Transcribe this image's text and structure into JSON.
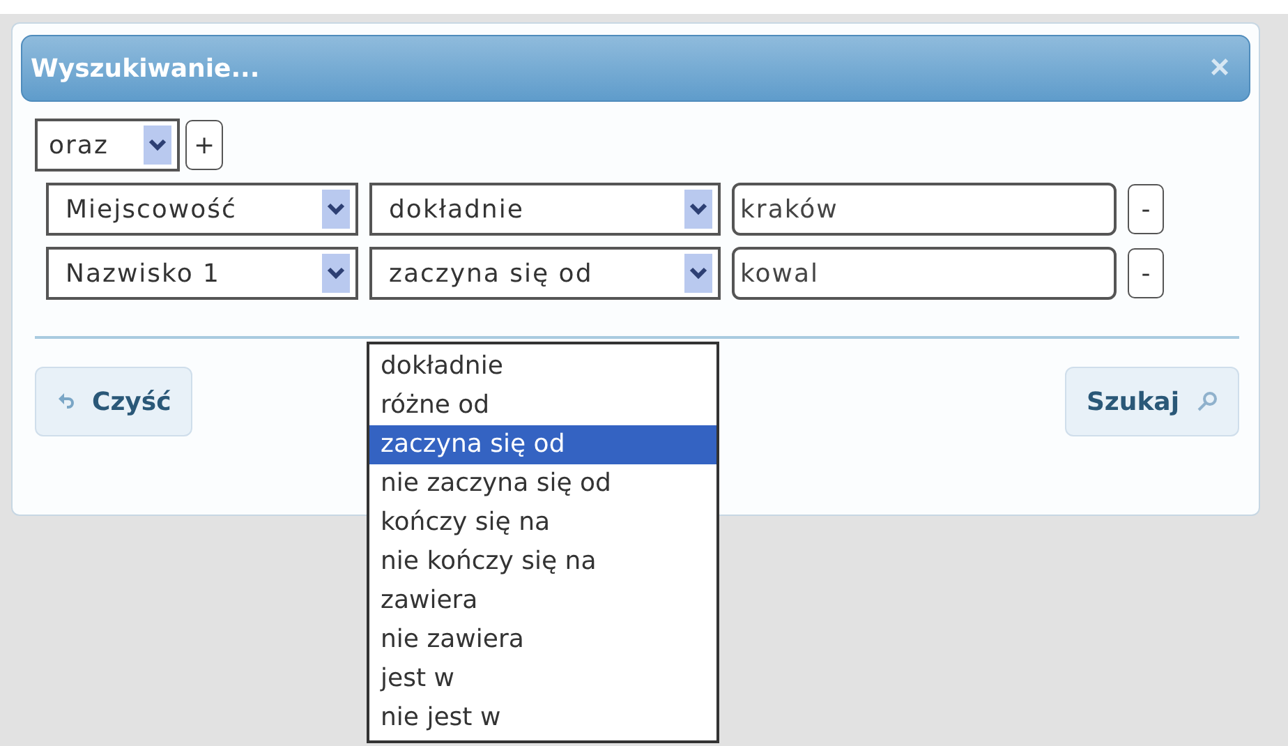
{
  "dialog": {
    "title": "Wyszukiwanie...",
    "close": "×"
  },
  "connector": {
    "value": "oraz",
    "add": "+"
  },
  "conditions": [
    {
      "field": "Miejscowość",
      "operator": "dokładnie",
      "value": "kraków",
      "remove": "-"
    },
    {
      "field": "Nazwisko 1",
      "operator": "zaczyna się od",
      "value": "kowal",
      "remove": "-",
      "operator_options": [
        {
          "label": "dokładnie",
          "selected": false
        },
        {
          "label": "różne od",
          "selected": false
        },
        {
          "label": "zaczyna się od",
          "selected": true
        },
        {
          "label": "nie zaczyna się od",
          "selected": false
        },
        {
          "label": "kończy się na",
          "selected": false
        },
        {
          "label": "nie kończy się na",
          "selected": false
        },
        {
          "label": "zawiera",
          "selected": false
        },
        {
          "label": "nie zawiera",
          "selected": false
        },
        {
          "label": "jest w",
          "selected": false
        },
        {
          "label": "nie jest w",
          "selected": false
        }
      ]
    }
  ],
  "buttons": {
    "clear": "Czyść",
    "search": "Szukaj"
  }
}
